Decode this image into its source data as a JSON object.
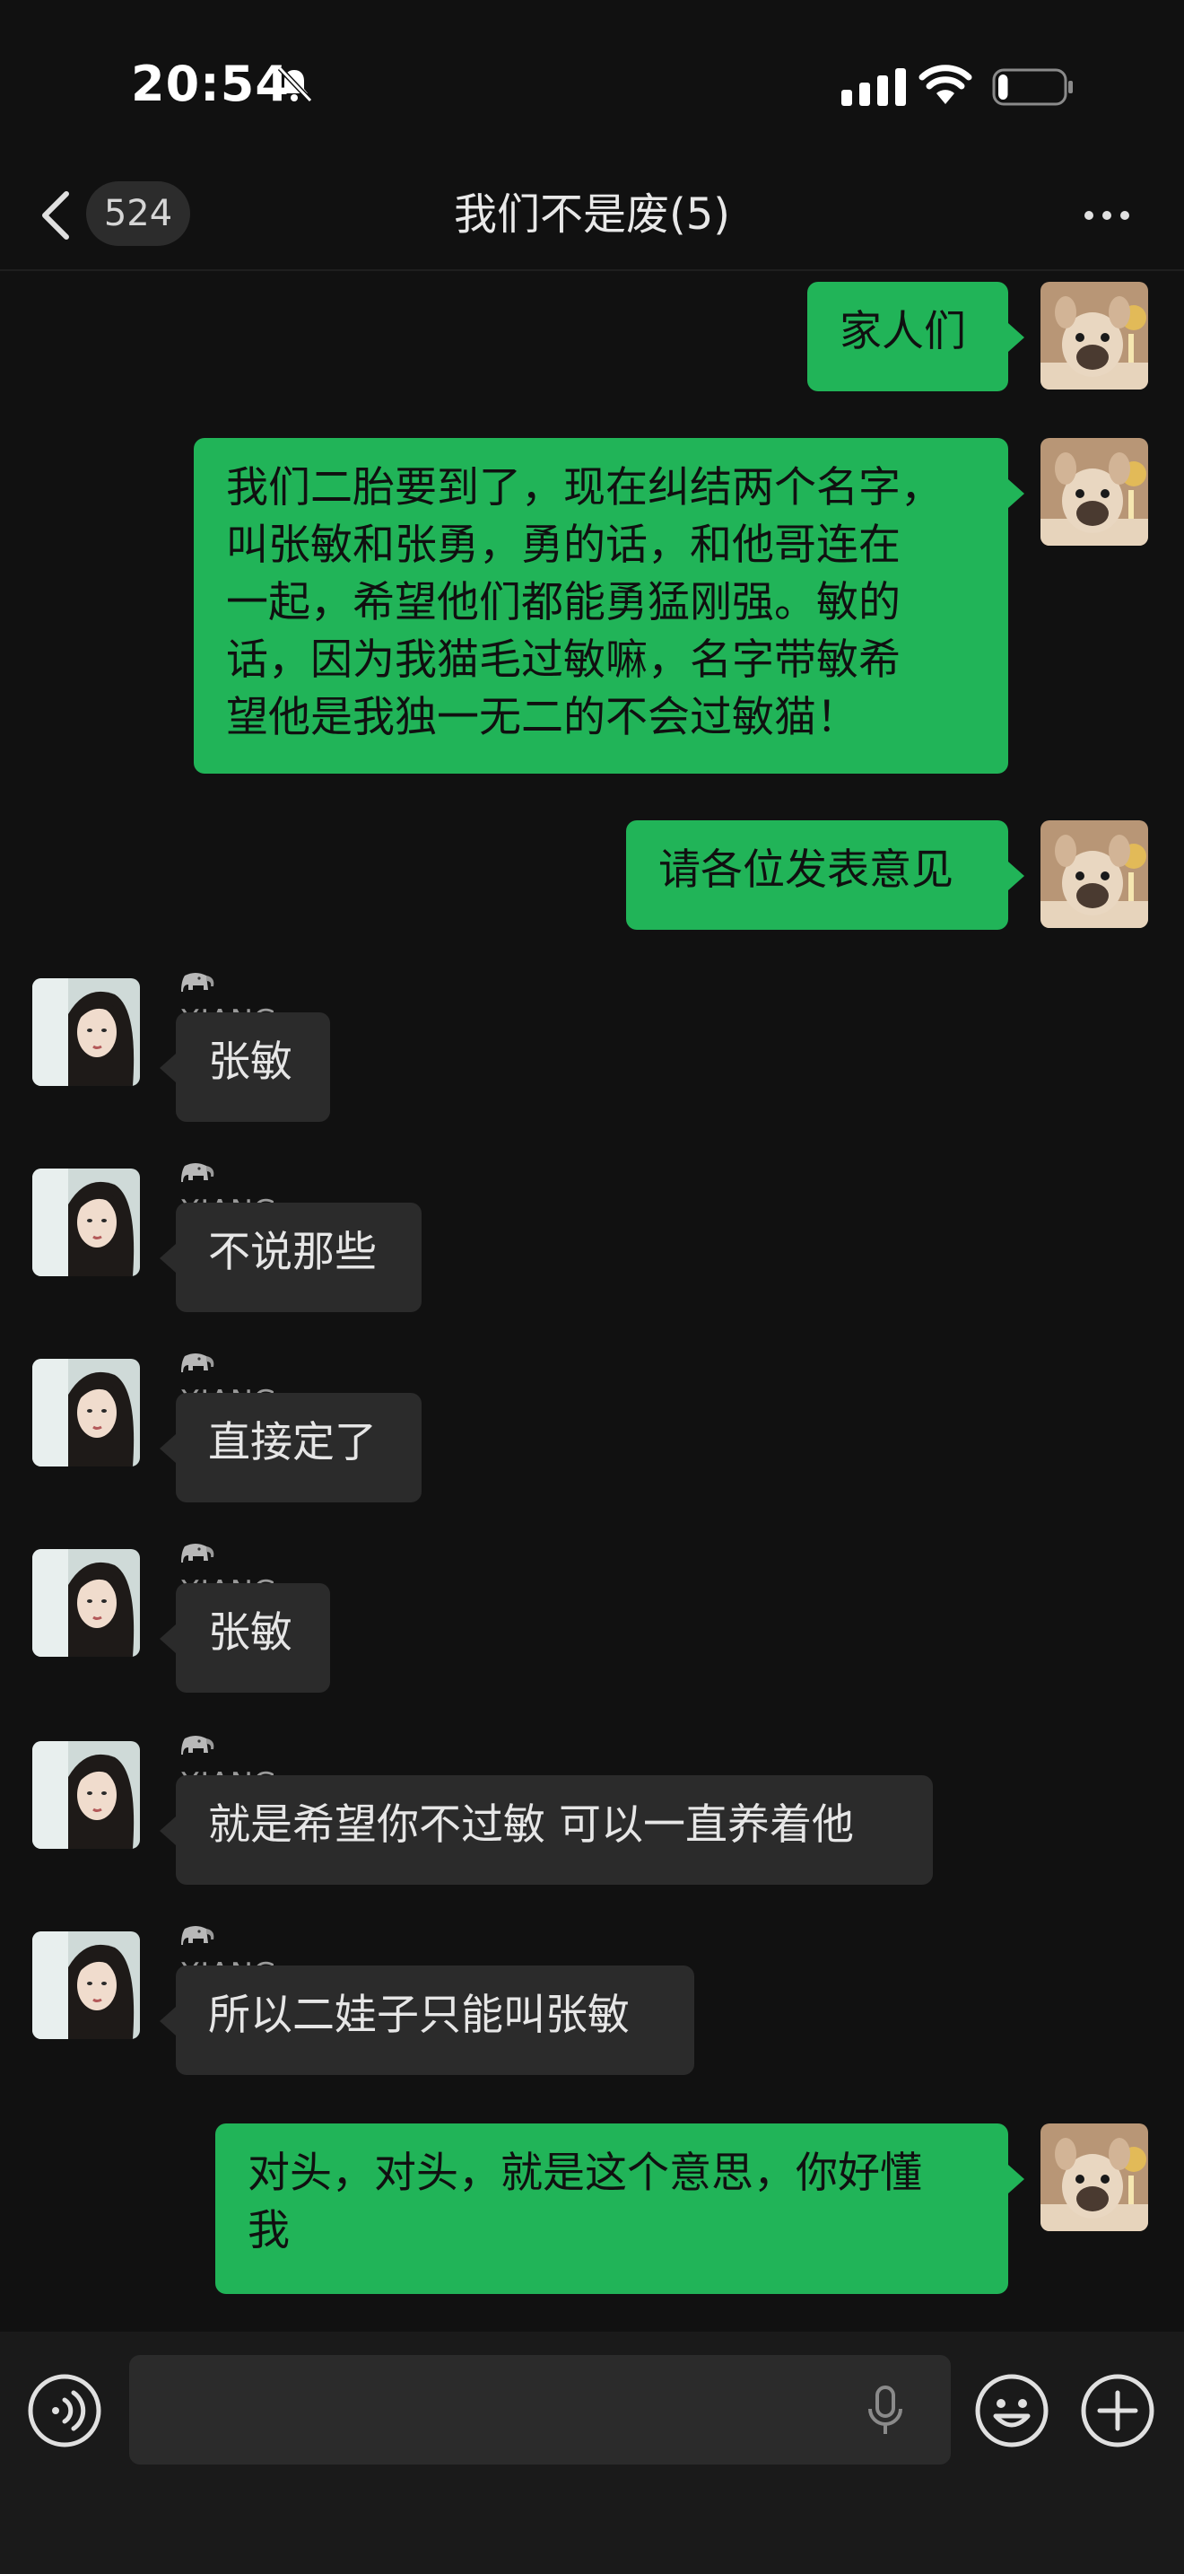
{
  "status_bar": {
    "time": "20:54",
    "battery_level": 0.15
  },
  "nav": {
    "unread_count": "524",
    "title": "我们不是废(5)"
  },
  "icons": {
    "back": "chevron-left-icon",
    "more": "more-dots-icon",
    "bell_off": "bell-off-icon",
    "voice": "voice-icon",
    "mic": "microphone-icon",
    "emoji": "emoji-icon",
    "plus": "plus-icon"
  },
  "colors": {
    "outgoing_bubble": "#21b458",
    "incoming_bubble": "#2b2b2b",
    "background": "#111111"
  },
  "messages": [
    {
      "direction": "out",
      "lines": [
        "家人们"
      ]
    },
    {
      "direction": "out",
      "lines": [
        "我们二胎要到了，现在纠结两个名字，",
        "叫张敏和张勇，勇的话，和他哥连在",
        "一起，希望他们都能勇猛刚强。敏的",
        "话，因为我猫毛过敏嘛，名字带敏希",
        "望他是我独一无二的不会过敏猫！"
      ]
    },
    {
      "direction": "out",
      "lines": [
        "请各位发表意见"
      ]
    },
    {
      "direction": "in",
      "sender": "XIANG",
      "lines": [
        "张敏"
      ]
    },
    {
      "direction": "in",
      "sender": "XIANG",
      "lines": [
        "不说那些"
      ]
    },
    {
      "direction": "in",
      "sender": "XIANG",
      "lines": [
        "直接定了"
      ]
    },
    {
      "direction": "in",
      "sender": "XIANG",
      "lines": [
        "张敏"
      ]
    },
    {
      "direction": "in",
      "sender": "XIANG",
      "lines": [
        "就是希望你不过敏 可以一直养着他"
      ]
    },
    {
      "direction": "in",
      "sender": "XIANG",
      "lines": [
        "所以二娃子只能叫张敏"
      ]
    },
    {
      "direction": "out",
      "lines": [
        "对头，对头，就是这个意思，你好懂",
        "我"
      ]
    }
  ]
}
